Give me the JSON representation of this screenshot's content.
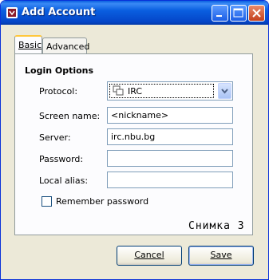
{
  "window": {
    "title": "Add Account"
  },
  "tabs": [
    {
      "label": "Basic"
    },
    {
      "label": "Advanced"
    }
  ],
  "section": {
    "title": "Login Options"
  },
  "fields": {
    "protocol": {
      "label": "Protocol:",
      "value": "IRC"
    },
    "screen_name": {
      "label": "Screen name:",
      "value": "<nickname>"
    },
    "server": {
      "label": "Server:",
      "value": "irc.nbu.bg"
    },
    "password": {
      "label": "Password:",
      "value": ""
    },
    "local_alias": {
      "label": "Local alias:",
      "value": ""
    }
  },
  "remember": {
    "label": "Remember password",
    "checked": false
  },
  "caption": "Снимка 3",
  "buttons": {
    "cancel": "Cancel",
    "save": "Save"
  },
  "icons": {
    "app": "app-icon",
    "minimize": "minimize-icon",
    "maximize": "maximize-icon",
    "close": "close-icon",
    "protocol": "irc-icon",
    "dropdown": "chevron-down-icon"
  },
  "colors": {
    "titlebar": "#0a5fe0",
    "close_button": "#c4401d",
    "tab_highlight": "#ffc73c",
    "window_bg": "#ece9d8"
  }
}
